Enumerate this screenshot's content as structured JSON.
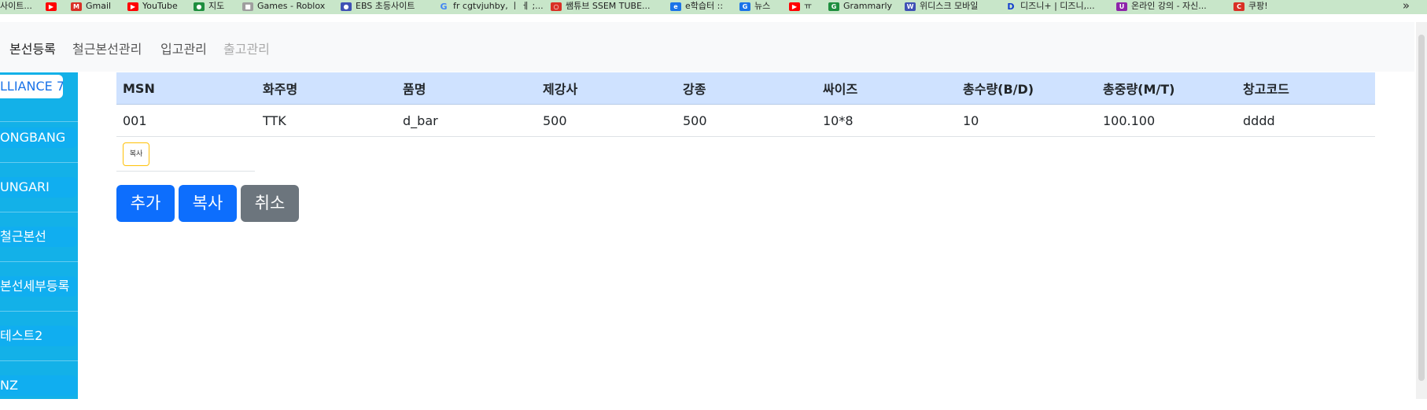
{
  "bookmarks": [
    {
      "label": "사이트...",
      "icon": "page-icon"
    },
    {
      "label": "",
      "icon": "youtube-icon"
    },
    {
      "label": "Gmail",
      "icon": "gmail-icon"
    },
    {
      "label": "YouTube",
      "icon": "youtube-icon"
    },
    {
      "label": "지도",
      "icon": "maps-pin-icon"
    },
    {
      "label": "Games - Roblox",
      "icon": "roblox-icon"
    },
    {
      "label": "EBS 초등사이트",
      "icon": "ebs-icon"
    },
    {
      "label": "fr cgtvjuhby, ㅣ ㅔ ;...",
      "icon": "google-icon"
    },
    {
      "label": "쌤튜브 SSEM TUBE...",
      "icon": "ssem-icon"
    },
    {
      "label": "e학습터 ::",
      "icon": "e-learning-icon"
    },
    {
      "label": "뉴스",
      "icon": "news-icon"
    },
    {
      "label": "ㅠ",
      "icon": "youtube-icon"
    },
    {
      "label": "Grammarly",
      "icon": "grammarly-icon"
    },
    {
      "label": "위디스크 모바일",
      "icon": "wedisk-icon"
    },
    {
      "label": "디즈니+ | 디즈니,...",
      "icon": "disney-icon"
    },
    {
      "label": "온라인 강의 - 자신...",
      "icon": "udemy-icon"
    },
    {
      "label": "쿠팡!",
      "icon": "coupang-icon"
    }
  ],
  "bookmarks_more": "»",
  "topnav": [
    "본선등록",
    "철근본선관리",
    "입고관리",
    "출고관리"
  ],
  "sidebar": [
    "LLIANCE 7",
    "ONGBANG",
    "UNGARI",
    "철근본선",
    "본선세부등록",
    "테스트2",
    "NZ"
  ],
  "table": {
    "headers": [
      "MSN",
      "화주명",
      "품명",
      "제강사",
      "강종",
      "싸이즈",
      "총수량(B/D)",
      "총중량(M/T)",
      "창고코드"
    ],
    "rows": [
      [
        "001",
        "TTK",
        "d_bar",
        "500",
        "500",
        "10*8",
        "10",
        "100.100",
        "dddd"
      ]
    ]
  },
  "row_copy_label": "복사",
  "buttons": {
    "add": "추가",
    "copy": "복사",
    "cancel": "취소"
  }
}
